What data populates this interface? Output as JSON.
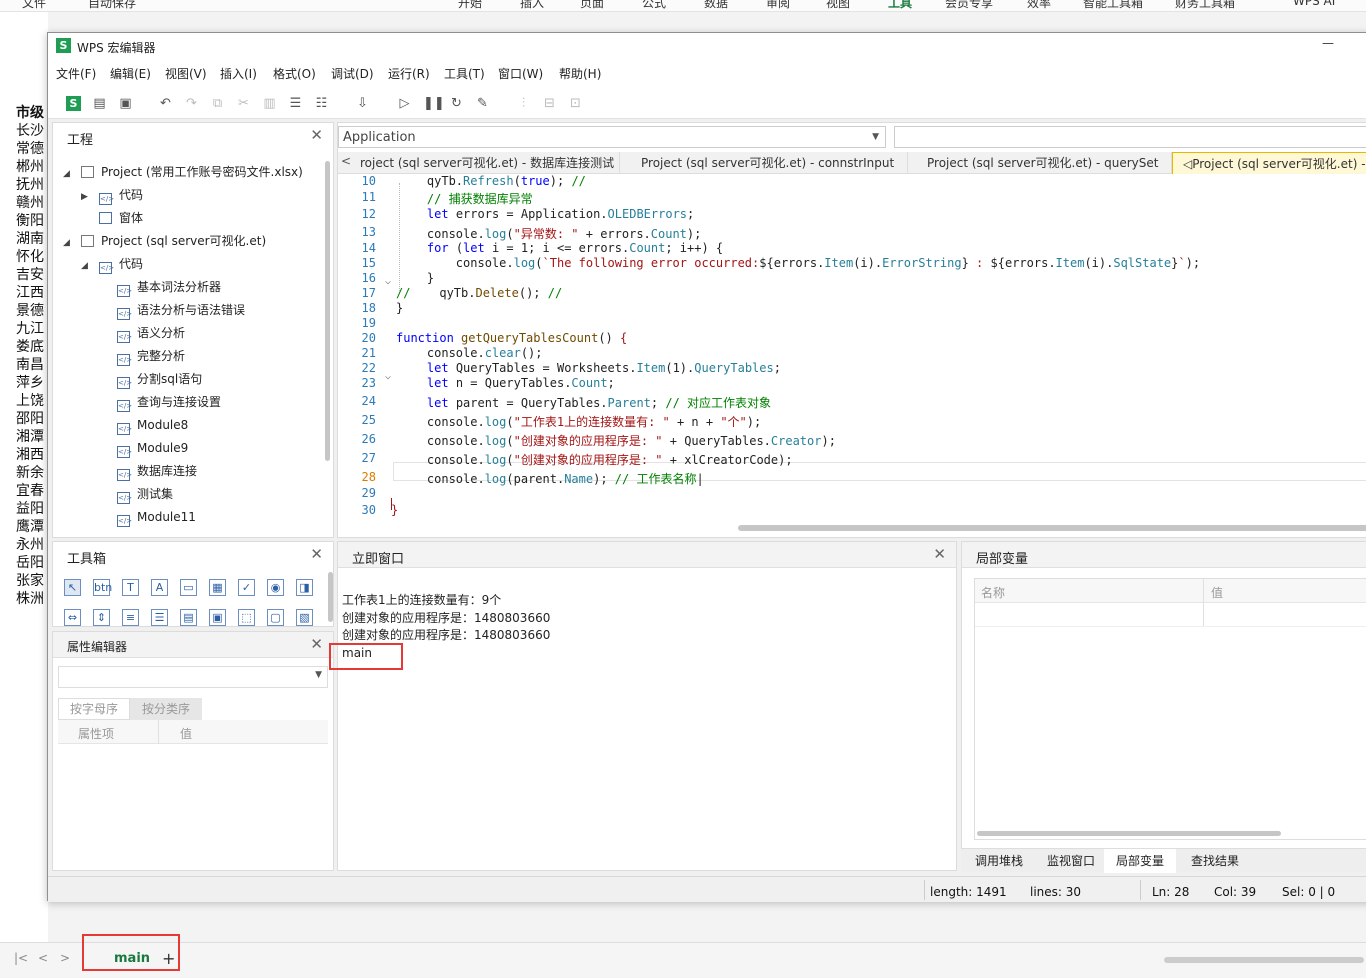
{
  "ribbon": {
    "quick": "文件",
    "autosave": "自动保存",
    "tabs": [
      "开始",
      "插入",
      "页面",
      "公式",
      "数据",
      "审阅",
      "视图",
      "工具",
      "会员专享",
      "效率",
      "智能工具箱",
      "财务工具箱",
      "WPS AI"
    ]
  },
  "sheet_cells": [
    "市级",
    "长沙",
    "常德",
    "郴州",
    "抚州",
    "赣州",
    "衡阳",
    "湖南",
    "怀化",
    "吉安",
    "江西",
    "景德",
    "九江",
    "娄底",
    "南昌",
    "萍乡",
    "上饶",
    "邵阳",
    "湘潭",
    "湘西",
    "新余",
    "宜春",
    "益阳",
    "鹰潭",
    "永州",
    "岳阳",
    "张家",
    "株洲"
  ],
  "sheet_tabs": {
    "active": "main",
    "add": "+"
  },
  "window": {
    "title": "WPS 宏编辑器",
    "minimize": "—"
  },
  "menu": [
    "文件(F)",
    "编辑(E)",
    "视图(V)",
    "插入(I)",
    "格式(O)",
    "调试(D)",
    "运行(R)",
    "工具(T)",
    "窗口(W)",
    "帮助(H)"
  ],
  "project": {
    "title": "工程",
    "close": "✕",
    "tree": [
      {
        "label": "Project (常用工作账号密码文件.xlsx)",
        "arrow": "◢"
      },
      {
        "label": "代码",
        "arrow": "▶"
      },
      {
        "label": "窗体",
        "arrow": ""
      },
      {
        "label": "Project (sql server可视化.et)",
        "arrow": "◢"
      },
      {
        "label": "代码",
        "arrow": "◢"
      },
      {
        "label": "基本词法分析器"
      },
      {
        "label": "语法分析与语法错误"
      },
      {
        "label": "语义分析"
      },
      {
        "label": "完整分析"
      },
      {
        "label": "分割sql语句"
      },
      {
        "label": "查询与连接设置"
      },
      {
        "label": "Module8"
      },
      {
        "label": "Module9"
      },
      {
        "label": "数据库连接"
      },
      {
        "label": "测试集"
      },
      {
        "label": "Module11"
      }
    ]
  },
  "toolbox": {
    "title": "工具箱",
    "close": "✕"
  },
  "props": {
    "title": "属性编辑器",
    "close": "✕",
    "sort_alpha": "按字母序",
    "sort_cat": "按分类序",
    "col_name": "属性项",
    "col_value": "值"
  },
  "editor": {
    "object_select": "Application",
    "tabs": [
      "roject (sql server可视化.et) - 数据库连接测试",
      "Project (sql server可视化.et) - connstrInput",
      "Project (sql server可视化.et) - querySet",
      "Project (sql server可视化.et) - main"
    ],
    "line_numbers": [
      "10",
      "11",
      "12",
      "13",
      "14",
      "15",
      "16",
      "17",
      "18",
      "19",
      "20",
      "21",
      "22",
      "23",
      "24",
      "25",
      "26",
      "27",
      "28",
      "29",
      "30"
    ]
  },
  "immediate": {
    "title": "立即窗口",
    "close": "✕",
    "lines": [
      "工作表1上的连接数量有：9个",
      "创建对象的应用程序是：1480803660",
      "创建对象的应用程序是：1480803660",
      "main"
    ]
  },
  "locals": {
    "title": "局部变量",
    "col_name": "名称",
    "col_value": "值"
  },
  "bottom_tabs": [
    "调用堆栈",
    "监视窗口",
    "局部变量",
    "查找结果"
  ],
  "status": {
    "length": "length: 1491",
    "lines": "lines: 30",
    "ln": "Ln: 28",
    "col": "Col: 39",
    "sel": "Sel: 0 | 0"
  }
}
